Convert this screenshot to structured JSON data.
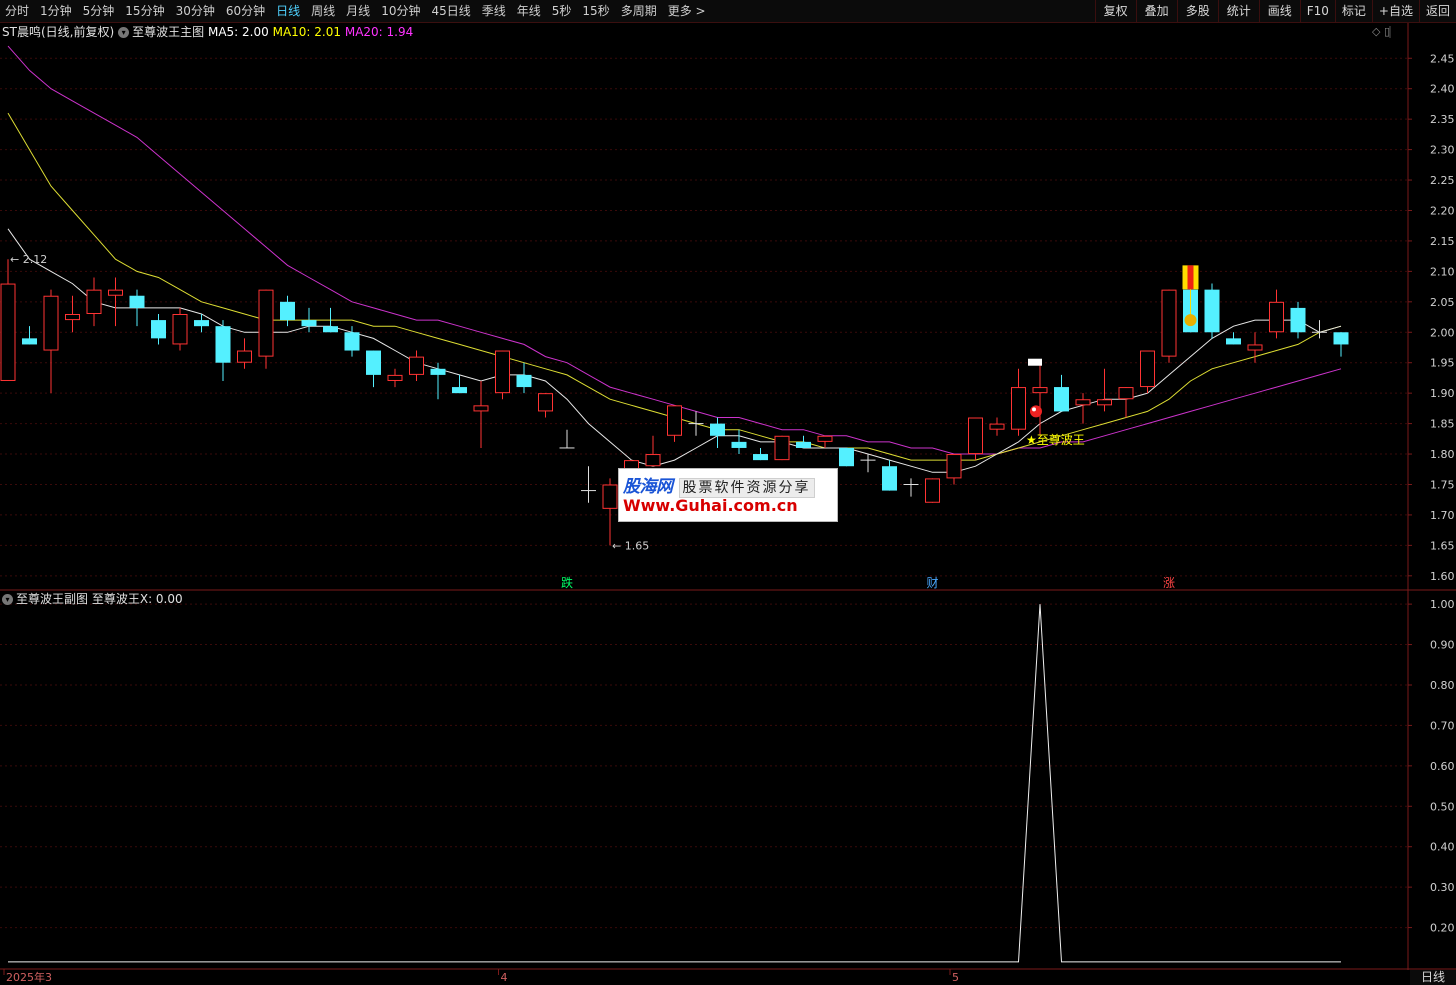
{
  "toolbar": {
    "periods": [
      {
        "label": "分时",
        "active": false
      },
      {
        "label": "1分钟",
        "active": false
      },
      {
        "label": "5分钟",
        "active": false
      },
      {
        "label": "15分钟",
        "active": false
      },
      {
        "label": "30分钟",
        "active": false
      },
      {
        "label": "60分钟",
        "active": false
      },
      {
        "label": "日线",
        "active": true
      },
      {
        "label": "周线",
        "active": false
      },
      {
        "label": "月线",
        "active": false
      },
      {
        "label": "10分钟",
        "active": false
      },
      {
        "label": "45日线",
        "active": false
      },
      {
        "label": "季线",
        "active": false
      },
      {
        "label": "年线",
        "active": false
      },
      {
        "label": "5秒",
        "active": false
      },
      {
        "label": "15秒",
        "active": false
      },
      {
        "label": "多周期",
        "active": false
      },
      {
        "label": "更多 >",
        "active": false
      }
    ],
    "tools": [
      "复权",
      "叠加",
      "多股",
      "统计",
      "画线",
      "F10",
      "标记",
      "+自选",
      "返回"
    ]
  },
  "main_header": {
    "stock": "ST晨鸣(日线,前复权)",
    "indicator": "至尊波王主图",
    "ma5": "MA5: 2.00",
    "ma10": "MA10: 2.01",
    "ma20": "MA20: 1.94"
  },
  "corner_icons": "◇ ▯",
  "sub_header": {
    "indicator": "至尊波王副图",
    "value": "至尊波王X: 0.00"
  },
  "watermark": {
    "logo": "股海网",
    "slogan": "股票软件资源分享",
    "url": "Www.Guhai.com.cn"
  },
  "period_label": "日线",
  "chart_data": [
    {
      "type": "candlestick",
      "ylim": [
        1.58,
        2.48
      ],
      "yticks": [
        "2.45",
        "2.40",
        "2.35",
        "2.30",
        "2.25",
        "2.20",
        "2.15",
        "2.10",
        "2.05",
        "2.00",
        "1.95",
        "1.90",
        "1.85",
        "1.80",
        "1.75",
        "1.70",
        "1.65",
        "1.60"
      ],
      "candles": [
        {
          "o": 1.92,
          "h": 2.12,
          "l": 1.92,
          "c": 2.08
        },
        {
          "o": 1.99,
          "h": 2.01,
          "l": 1.98,
          "c": 1.98
        },
        {
          "o": 1.97,
          "h": 2.07,
          "l": 1.9,
          "c": 2.06
        },
        {
          "o": 2.02,
          "h": 2.06,
          "l": 2.0,
          "c": 2.03
        },
        {
          "o": 2.03,
          "h": 2.09,
          "l": 2.01,
          "c": 2.07
        },
        {
          "o": 2.06,
          "h": 2.09,
          "l": 2.01,
          "c": 2.07
        },
        {
          "o": 2.06,
          "h": 2.07,
          "l": 2.01,
          "c": 2.04
        },
        {
          "o": 2.02,
          "h": 2.03,
          "l": 1.98,
          "c": 1.99
        },
        {
          "o": 1.98,
          "h": 2.04,
          "l": 1.97,
          "c": 2.03
        },
        {
          "o": 2.02,
          "h": 2.03,
          "l": 2.0,
          "c": 2.01
        },
        {
          "o": 2.01,
          "h": 2.02,
          "l": 1.92,
          "c": 1.95
        },
        {
          "o": 1.95,
          "h": 1.99,
          "l": 1.94,
          "c": 1.97
        },
        {
          "o": 1.96,
          "h": 2.07,
          "l": 1.94,
          "c": 2.07
        },
        {
          "o": 2.05,
          "h": 2.06,
          "l": 2.01,
          "c": 2.02
        },
        {
          "o": 2.02,
          "h": 2.04,
          "l": 2.0,
          "c": 2.01
        },
        {
          "o": 2.01,
          "h": 2.04,
          "l": 2.0,
          "c": 2.0
        },
        {
          "o": 2.0,
          "h": 2.01,
          "l": 1.96,
          "c": 1.97
        },
        {
          "o": 1.97,
          "h": 1.97,
          "l": 1.91,
          "c": 1.93
        },
        {
          "o": 1.92,
          "h": 1.94,
          "l": 1.91,
          "c": 1.93
        },
        {
          "o": 1.93,
          "h": 1.97,
          "l": 1.92,
          "c": 1.96
        },
        {
          "o": 1.94,
          "h": 1.95,
          "l": 1.89,
          "c": 1.93
        },
        {
          "o": 1.91,
          "h": 1.93,
          "l": 1.9,
          "c": 1.9
        },
        {
          "o": 1.87,
          "h": 1.92,
          "l": 1.81,
          "c": 1.88
        },
        {
          "o": 1.9,
          "h": 1.97,
          "l": 1.89,
          "c": 1.97
        },
        {
          "o": 1.93,
          "h": 1.95,
          "l": 1.9,
          "c": 1.91
        },
        {
          "o": 1.87,
          "h": 1.9,
          "l": 1.86,
          "c": 1.9
        },
        {
          "o": 1.81,
          "h": 1.84,
          "l": 1.81,
          "c": 1.81
        },
        {
          "o": 1.74,
          "h": 1.78,
          "l": 1.72,
          "c": 1.74
        },
        {
          "o": 1.71,
          "h": 1.76,
          "l": 1.65,
          "c": 1.75
        },
        {
          "o": 1.77,
          "h": 1.79,
          "l": 1.76,
          "c": 1.79
        },
        {
          "o": 1.78,
          "h": 1.83,
          "l": 1.78,
          "c": 1.8
        },
        {
          "o": 1.83,
          "h": 1.88,
          "l": 1.82,
          "c": 1.88
        },
        {
          "o": 1.85,
          "h": 1.87,
          "l": 1.83,
          "c": 1.85
        },
        {
          "o": 1.85,
          "h": 1.86,
          "l": 1.81,
          "c": 1.83
        },
        {
          "o": 1.82,
          "h": 1.84,
          "l": 1.8,
          "c": 1.81
        },
        {
          "o": 1.8,
          "h": 1.81,
          "l": 1.79,
          "c": 1.79
        },
        {
          "o": 1.79,
          "h": 1.83,
          "l": 1.79,
          "c": 1.83
        },
        {
          "o": 1.82,
          "h": 1.83,
          "l": 1.81,
          "c": 1.81
        },
        {
          "o": 1.82,
          "h": 1.83,
          "l": 1.81,
          "c": 1.83
        },
        {
          "o": 1.81,
          "h": 1.81,
          "l": 1.78,
          "c": 1.78
        },
        {
          "o": 1.79,
          "h": 1.8,
          "l": 1.77,
          "c": 1.79
        },
        {
          "o": 1.78,
          "h": 1.79,
          "l": 1.74,
          "c": 1.74
        },
        {
          "o": 1.75,
          "h": 1.76,
          "l": 1.73,
          "c": 1.75
        },
        {
          "o": 1.72,
          "h": 1.76,
          "l": 1.72,
          "c": 1.76
        },
        {
          "o": 1.76,
          "h": 1.8,
          "l": 1.75,
          "c": 1.8
        },
        {
          "o": 1.8,
          "h": 1.86,
          "l": 1.79,
          "c": 1.86
        },
        {
          "o": 1.84,
          "h": 1.86,
          "l": 1.83,
          "c": 1.85
        },
        {
          "o": 1.84,
          "h": 1.94,
          "l": 1.83,
          "c": 1.91
        },
        {
          "o": 1.9,
          "h": 1.95,
          "l": 1.83,
          "c": 1.91
        },
        {
          "o": 1.91,
          "h": 1.93,
          "l": 1.87,
          "c": 1.87
        },
        {
          "o": 1.88,
          "h": 1.9,
          "l": 1.85,
          "c": 1.89
        },
        {
          "o": 1.88,
          "h": 1.94,
          "l": 1.87,
          "c": 1.89
        },
        {
          "o": 1.89,
          "h": 1.91,
          "l": 1.86,
          "c": 1.91
        },
        {
          "o": 1.91,
          "h": 1.96,
          "l": 1.9,
          "c": 1.97
        },
        {
          "o": 1.96,
          "h": 2.07,
          "l": 1.95,
          "c": 2.07
        },
        {
          "o": 2.07,
          "h": 2.07,
          "l": 2.0,
          "c": 2.0
        },
        {
          "o": 2.07,
          "h": 2.08,
          "l": 1.99,
          "c": 2.0
        },
        {
          "o": 1.99,
          "h": 2.0,
          "l": 1.98,
          "c": 1.98
        },
        {
          "o": 1.97,
          "h": 2.0,
          "l": 1.95,
          "c": 1.98
        },
        {
          "o": 2.0,
          "h": 2.07,
          "l": 1.99,
          "c": 2.05
        },
        {
          "o": 2.04,
          "h": 2.05,
          "l": 1.99,
          "c": 2.0
        },
        {
          "o": 2.0,
          "h": 2.02,
          "l": 1.99,
          "c": 2.0
        },
        {
          "o": 2.0,
          "h": 2.0,
          "l": 1.96,
          "c": 1.98
        }
      ],
      "ma5": [
        2.17,
        2.12,
        2.1,
        2.08,
        2.05,
        2.04,
        2.04,
        2.04,
        2.04,
        2.03,
        2.01,
        2.0,
        2.0,
        2.0,
        2.01,
        2.01,
        2.0,
        1.99,
        1.97,
        1.95,
        1.94,
        1.93,
        1.92,
        1.93,
        1.93,
        1.92,
        1.89,
        1.85,
        1.82,
        1.79,
        1.78,
        1.79,
        1.81,
        1.83,
        1.83,
        1.82,
        1.82,
        1.81,
        1.81,
        1.81,
        1.8,
        1.79,
        1.78,
        1.77,
        1.77,
        1.78,
        1.8,
        1.82,
        1.85,
        1.87,
        1.88,
        1.89,
        1.89,
        1.9,
        1.93,
        1.96,
        1.99,
        2.01,
        2.02,
        2.02,
        2.02,
        2.0,
        2.01
      ],
      "ma10": [
        2.36,
        2.3,
        2.24,
        2.2,
        2.16,
        2.12,
        2.1,
        2.09,
        2.07,
        2.05,
        2.04,
        2.03,
        2.02,
        2.02,
        2.02,
        2.02,
        2.02,
        2.01,
        2.01,
        2.0,
        1.99,
        1.98,
        1.97,
        1.96,
        1.95,
        1.94,
        1.93,
        1.91,
        1.89,
        1.88,
        1.87,
        1.86,
        1.85,
        1.84,
        1.84,
        1.83,
        1.82,
        1.82,
        1.81,
        1.81,
        1.81,
        1.8,
        1.79,
        1.79,
        1.79,
        1.79,
        1.8,
        1.81,
        1.82,
        1.83,
        1.84,
        1.85,
        1.86,
        1.87,
        1.89,
        1.92,
        1.94,
        1.95,
        1.96,
        1.97,
        1.98,
        2.0,
        2.01
      ],
      "ma20": [
        2.47,
        2.43,
        2.4,
        2.38,
        2.36,
        2.34,
        2.32,
        2.29,
        2.26,
        2.23,
        2.2,
        2.17,
        2.14,
        2.11,
        2.09,
        2.07,
        2.05,
        2.04,
        2.03,
        2.02,
        2.02,
        2.01,
        2.0,
        1.99,
        1.98,
        1.96,
        1.95,
        1.93,
        1.91,
        1.9,
        1.89,
        1.88,
        1.87,
        1.86,
        1.86,
        1.85,
        1.84,
        1.84,
        1.83,
        1.83,
        1.82,
        1.82,
        1.81,
        1.81,
        1.8,
        1.8,
        1.8,
        1.81,
        1.81,
        1.82,
        1.82,
        1.83,
        1.84,
        1.85,
        1.86,
        1.87,
        1.88,
        1.89,
        1.9,
        1.91,
        1.92,
        1.93,
        1.94
      ],
      "annotations": [
        {
          "text": "2.12",
          "index": 0,
          "price": 2.12
        },
        {
          "text": "1.65",
          "index": 28,
          "price": 1.65
        },
        {
          "text": "★至尊波王",
          "index": 48,
          "price": 1.83
        }
      ],
      "markers": [
        {
          "text": "跌",
          "index": 26,
          "color": "#00ff66"
        },
        {
          "text": "财",
          "index": 43,
          "color": "#4aa8ff"
        },
        {
          "text": "涨",
          "index": 54,
          "color": "#ff4444"
        }
      ]
    },
    {
      "type": "line",
      "ylim": [
        0.1,
        1.03
      ],
      "yticks": [
        "1.00",
        "0.90",
        "0.80",
        "0.70",
        "0.60",
        "0.50",
        "0.40",
        "0.30",
        "0.20"
      ],
      "x_labels": [
        {
          "text": "2025年3",
          "index": 0
        },
        {
          "text": "4",
          "index": 23
        },
        {
          "text": "5",
          "index": 44
        }
      ],
      "values": [
        0,
        0,
        0,
        0,
        0,
        0,
        0,
        0,
        0,
        0,
        0,
        0,
        0,
        0,
        0,
        0,
        0,
        0,
        0,
        0,
        0,
        0,
        0,
        0,
        0,
        0,
        0,
        0,
        0,
        0,
        0,
        0,
        0,
        0,
        0,
        0,
        0,
        0,
        0,
        0,
        0,
        0,
        0,
        0,
        0,
        0,
        0,
        0,
        1,
        0,
        0,
        0,
        0,
        0,
        0,
        0,
        0,
        0,
        0,
        0,
        0,
        0,
        0
      ]
    }
  ]
}
